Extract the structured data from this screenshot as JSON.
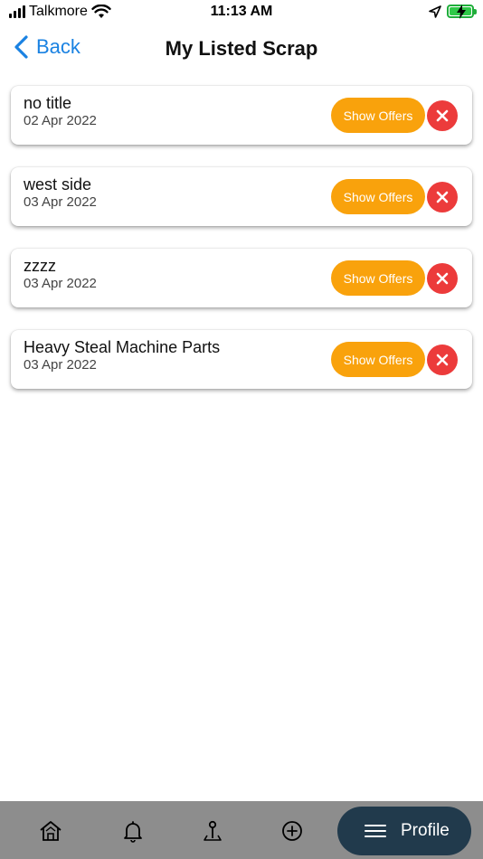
{
  "status_bar": {
    "carrier": "Talkmore",
    "time": "11:13 AM",
    "icons": [
      "signal-icon",
      "wifi-icon",
      "location-arrow-icon",
      "battery-charging-icon"
    ]
  },
  "nav": {
    "back_label": "Back",
    "title": "My Listed Scrap"
  },
  "colors": {
    "accent_blue": "#1a82e2",
    "offers_orange": "#f9a20c",
    "delete_red": "#ec3b3b",
    "tab_bar_gray": "#8d8d8d",
    "profile_navy": "#213a4c"
  },
  "listings": [
    {
      "title": "no title",
      "date": "02 Apr 2022",
      "action_label": "Show Offers"
    },
    {
      "title": "west side",
      "date": "03 Apr 2022",
      "action_label": "Show Offers"
    },
    {
      "title": "zzzz",
      "date": "03 Apr 2022",
      "action_label": "Show Offers"
    },
    {
      "title": "Heavy Steal Machine Parts",
      "date": "03 Apr 2022",
      "action_label": "Show Offers"
    }
  ],
  "tab_bar": {
    "tabs": [
      {
        "icon": "home-icon"
      },
      {
        "icon": "bell-icon"
      },
      {
        "icon": "map-pin-icon"
      },
      {
        "icon": "add-circle-icon"
      }
    ],
    "active_label": "Profile",
    "active_icon": "menu-icon"
  }
}
